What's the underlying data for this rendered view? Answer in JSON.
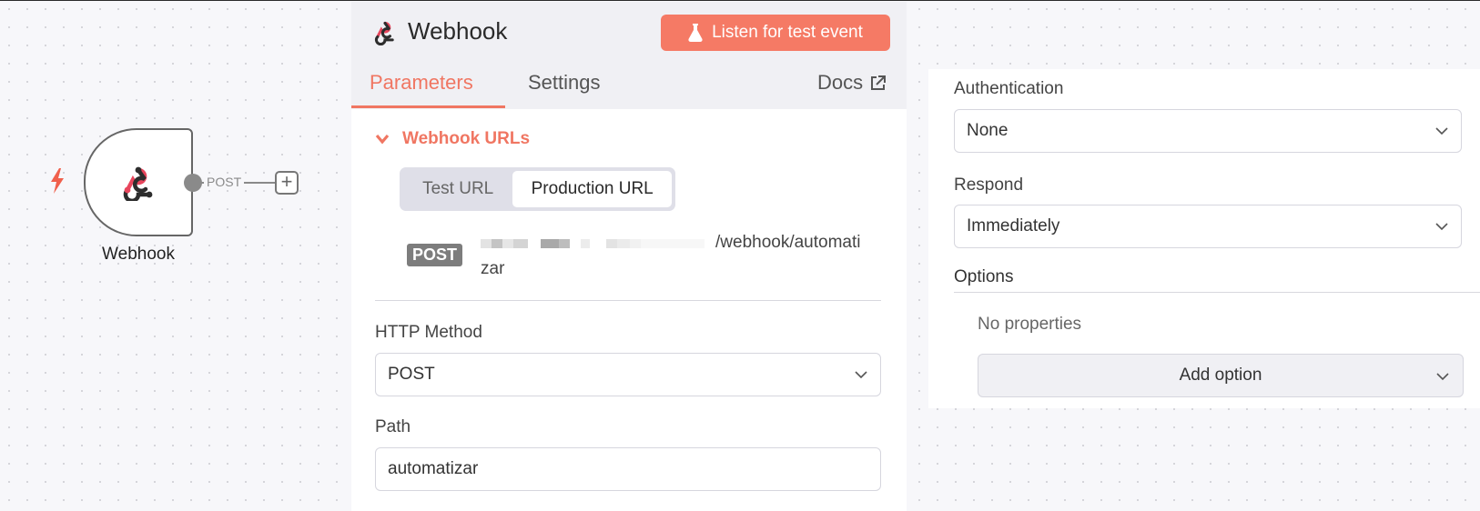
{
  "canvas": {
    "node_label": "Webhook",
    "edge_label": "POST",
    "add_symbol": "+",
    "trigger_icon": "lightning-bolt-icon",
    "node_icon": "webhook-icon"
  },
  "panel": {
    "title": "Webhook",
    "listen_button": "Listen for test event",
    "tabs": {
      "parameters": "Parameters",
      "settings": "Settings",
      "docs": "Docs"
    },
    "webhook_urls": {
      "section_title": "Webhook URLs",
      "test_label": "Test URL",
      "production_label": "Production URL",
      "selected": "Production URL",
      "method": "POST",
      "url_visible_suffix_line1": "/webhook/automati",
      "url_visible_suffix_line2": "zar"
    },
    "http_method": {
      "label": "HTTP Method",
      "value": "POST"
    },
    "path": {
      "label": "Path",
      "value": "automatizar"
    }
  },
  "right_panel": {
    "authentication": {
      "label": "Authentication",
      "value": "None"
    },
    "respond": {
      "label": "Respond",
      "value": "Immediately"
    },
    "options": {
      "label": "Options",
      "empty_text": "No properties",
      "add_button": "Add option"
    }
  },
  "colors": {
    "accent": "#f07662",
    "listen_button_bg": "#f57a65",
    "method_badge_bg": "#7d7d7d"
  }
}
